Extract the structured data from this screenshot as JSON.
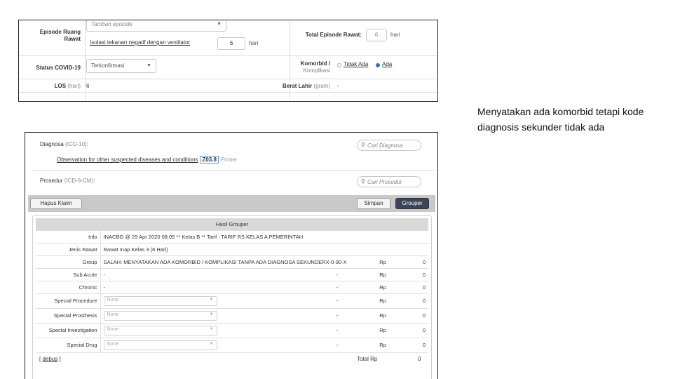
{
  "panel1": {
    "episode_label": "Episode Ruang Rawat",
    "episode_placeholder": "Tambah episode",
    "isolation_link": "Isolasi tekanan negatif dengan ventilator",
    "isolation_value": "6",
    "isolation_unit": "hari",
    "total_label": "Total Episode Rawat:",
    "total_value": "6",
    "total_unit": "hari",
    "covid_label": "Status COVID-19",
    "covid_value": "Terkonfirmasi",
    "comorbid_label_line1": "Komorbid /",
    "comorbid_label_line2": "Komplikasi",
    "comorbid_opt_no": "Tidak Ada",
    "comorbid_opt_yes": "Ada",
    "los_label": "LOS",
    "los_unit": "(hari)",
    "los_value": "6",
    "birth_label": "Berat Lahir",
    "birth_unit": "(gram)",
    "birth_value": "-"
  },
  "annotation": {
    "text": "Menyatakan ada komorbid tetapi kode diagnosis sekunder tidak ada"
  },
  "panel2": {
    "diagnosa_label": "Diagnosa",
    "diagnosa_code_type": "(ICD-10)",
    "diagnosa_colon": ":",
    "dx_search_placeholder": "Cari Diagnosa",
    "dx_text": "Observation for other suspected diseases and conditions",
    "dx_code": "Z03.8",
    "dx_role": "Primer",
    "prosedur_label": "Prosedur",
    "prosedur_code_type": "(ICD-9-CM)",
    "prosedur_colon": ":",
    "px_search_placeholder": "Cari Prosedur",
    "buttons": {
      "delete": "Hapus Klaim",
      "save": "Simpan",
      "grouper": "Grouper"
    },
    "result": {
      "title": "Hasil Grouper",
      "info_label": "Info",
      "info_value": "INACBG @ 29 Apr 2020 08:05 ** Kelas B ** Tarif : TARIF RS KELAS A PEMERINTAH",
      "jenis_label": "Jenis Rawat",
      "jenis_value": "Rawat Inap Kelas 3 (6 Hari)",
      "group_label": "Group",
      "group_value": "SALAH: MENYATAKAN ADA KOMORBID / KOMPLIKASI TANPA ADA DIAGNOSA SEKUNDER",
      "group_code": "X-0-90-X",
      "group_rp": "Rp",
      "group_amt": "0",
      "sub_label": "Sub Acute",
      "sub_value": "-",
      "sub_dash": "-",
      "sub_rp": "Rp",
      "sub_amt": "0",
      "chronic_label": "Chronic",
      "chronic_value": "-",
      "chronic_dash": "-",
      "chronic_rp": "Rp",
      "chronic_amt": "0",
      "sp_proc_label": "Special Procedure",
      "sp_proc_value": "None",
      "sp_proc_dash": "-",
      "sp_proc_rp": "Rp",
      "sp_proc_amt": "0",
      "sp_pros_label": "Special Prosthesis",
      "sp_pros_value": "None",
      "sp_pros_dash": "-",
      "sp_pros_rp": "Rp",
      "sp_pros_amt": "0",
      "sp_inv_label": "Special Investigation",
      "sp_inv_value": "None",
      "sp_inv_dash": "-",
      "sp_inv_rp": "Rp",
      "sp_inv_amt": "0",
      "sp_drug_label": "Special Drug",
      "sp_drug_value": "None",
      "sp_drug_dash": "-",
      "sp_drug_rp": "Rp",
      "sp_drug_amt": "0",
      "debug_link": "debus",
      "total_label": "Total Rp",
      "total_amt": "0"
    }
  },
  "icons": {
    "search": "magnifier-icon",
    "caret": "chevron-down-icon"
  },
  "colors": {
    "accent": "#3f6fb5",
    "grouper_button": "#3b4556",
    "toolbar": "#c9c9c9"
  }
}
